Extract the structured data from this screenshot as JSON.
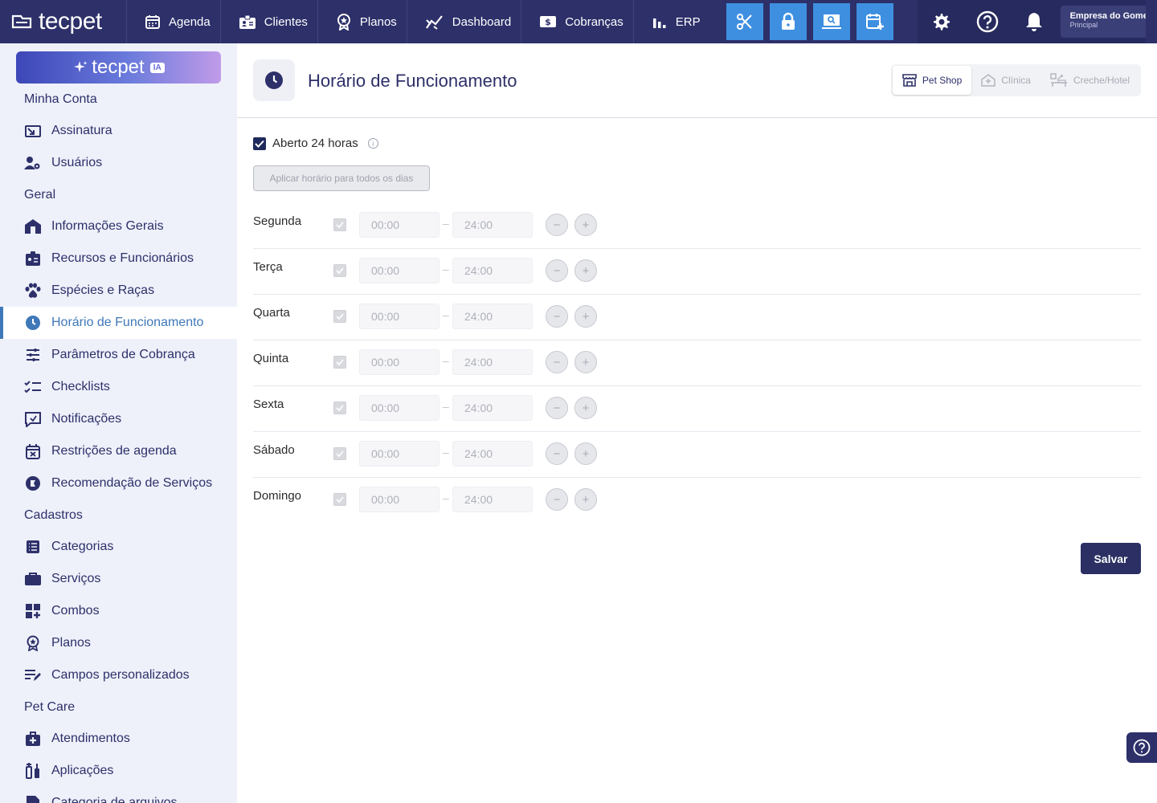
{
  "brand": {
    "logo_text": "tecpet",
    "ia_text": "tecpet",
    "ia_badge": "IA"
  },
  "topnav": [
    {
      "label": "Agenda",
      "icon": "calendar-icon"
    },
    {
      "label": "Clientes",
      "icon": "id-card-icon"
    },
    {
      "label": "Planos",
      "icon": "award-icon"
    },
    {
      "label": "Dashboard",
      "icon": "chart-line-icon"
    },
    {
      "label": "Cobranças",
      "icon": "dollar-icon"
    },
    {
      "label": "ERP",
      "icon": "bar-chart-icon"
    }
  ],
  "tools": [
    "scissors-icon",
    "lock-icon",
    "laptop-search-icon",
    "calendar-plus-icon"
  ],
  "company": {
    "name": "Empresa do Gomes",
    "subtitle": "Principal"
  },
  "sidebar": {
    "sections": [
      {
        "title": "Minha Conta",
        "items": [
          {
            "label": "Assinatura"
          },
          {
            "label": "Usuários"
          }
        ]
      },
      {
        "title": "Geral",
        "items": [
          {
            "label": "Informações Gerais"
          },
          {
            "label": "Recursos e Funcionários"
          },
          {
            "label": "Espécies e Raças"
          },
          {
            "label": "Horário de Funcionamento"
          },
          {
            "label": "Parâmetros de Cobrança"
          },
          {
            "label": "Checklists"
          },
          {
            "label": "Notificações"
          },
          {
            "label": "Restrições de agenda"
          },
          {
            "label": "Recomendação de Serviços"
          }
        ]
      },
      {
        "title": "Cadastros",
        "items": [
          {
            "label": "Categorias"
          },
          {
            "label": "Serviços"
          },
          {
            "label": "Combos"
          },
          {
            "label": "Planos"
          },
          {
            "label": "Campos personalizados"
          }
        ]
      },
      {
        "title": "Pet Care",
        "items": [
          {
            "label": "Atendimentos"
          },
          {
            "label": "Aplicações"
          },
          {
            "label": "Categoria de arquivos"
          }
        ]
      }
    ],
    "active": "Horário de Funcionamento"
  },
  "page": {
    "title": "Horário de Funcionamento",
    "segments": [
      {
        "label": "Pet Shop",
        "selected": true
      },
      {
        "label": "Clínica",
        "selected": false
      },
      {
        "label": "Creche/Hotel",
        "selected": false
      }
    ],
    "open24_label": "Aberto 24 horas",
    "open24_checked": true,
    "apply_label": "Aplicar horário para todos os dias",
    "days": [
      {
        "day": "Segunda",
        "start": "00:00",
        "end": "24:00"
      },
      {
        "day": "Terça",
        "start": "00:00",
        "end": "24:00"
      },
      {
        "day": "Quarta",
        "start": "00:00",
        "end": "24:00"
      },
      {
        "day": "Quinta",
        "start": "00:00",
        "end": "24:00"
      },
      {
        "day": "Sexta",
        "start": "00:00",
        "end": "24:00"
      },
      {
        "day": "Sábado",
        "start": "00:00",
        "end": "24:00"
      },
      {
        "day": "Domingo",
        "start": "00:00",
        "end": "24:00"
      }
    ],
    "save_label": "Salvar"
  },
  "colors": {
    "nav": "#2d3069",
    "accent": "#3e8fe0",
    "active": "#3f78b8"
  }
}
